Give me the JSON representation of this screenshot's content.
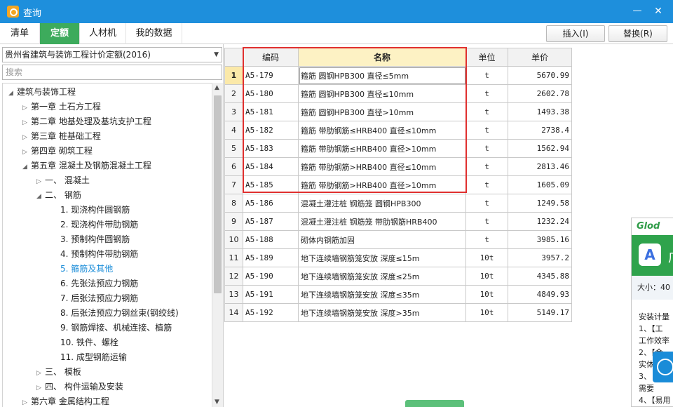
{
  "window": {
    "title": "查询",
    "minimize": "—",
    "close": "✕"
  },
  "tabs": [
    {
      "label": "清单"
    },
    {
      "label": "定额"
    },
    {
      "label": "人材机"
    },
    {
      "label": "我的数据"
    }
  ],
  "toolbar": {
    "insert": "插入(I)",
    "replace": "替换(R)"
  },
  "left": {
    "dropdown_value": "贵州省建筑与装饰工程计价定额(2016)",
    "search_placeholder": "搜索",
    "tree": [
      {
        "label": "建筑与装饰工程",
        "state": "expanded"
      },
      {
        "label": "第一章 土石方工程",
        "state": "collapsed"
      },
      {
        "label": "第二章 地基处理及基坑支护工程",
        "state": "collapsed"
      },
      {
        "label": "第三章 桩基础工程",
        "state": "collapsed"
      },
      {
        "label": "第四章 砌筑工程",
        "state": "collapsed"
      },
      {
        "label": "第五章 混凝土及钢筋混凝土工程",
        "state": "expanded"
      },
      {
        "label": "一、 混凝土",
        "state": "collapsed"
      },
      {
        "label": "二、 钢筋",
        "state": "expanded"
      },
      {
        "label": "1. 现浇构件圆钢筋",
        "state": "leaf"
      },
      {
        "label": "2. 现浇构件带肋钢筋",
        "state": "leaf"
      },
      {
        "label": "3. 预制构件圆钢筋",
        "state": "leaf"
      },
      {
        "label": "4. 预制构件带肋钢筋",
        "state": "leaf"
      },
      {
        "label": "5. 箍筋及其他",
        "state": "leaf",
        "selected": true
      },
      {
        "label": "6. 先张法预应力钢筋",
        "state": "leaf"
      },
      {
        "label": "7. 后张法预应力钢筋",
        "state": "leaf"
      },
      {
        "label": "8. 后张法预应力钢丝束(钢绞线)",
        "state": "leaf"
      },
      {
        "label": "9. 钢筋焊接、机械连接、植筋",
        "state": "leaf"
      },
      {
        "label": "10. 铁件、螺栓",
        "state": "leaf"
      },
      {
        "label": "11. 成型钢筋运输",
        "state": "leaf"
      },
      {
        "label": "三、 模板",
        "state": "collapsed"
      },
      {
        "label": "四、 构件运输及安装",
        "state": "collapsed"
      },
      {
        "label": "第六章 金属结构工程",
        "state": "collapsed"
      }
    ]
  },
  "grid": {
    "headers": {
      "code": "编码",
      "name": "名称",
      "unit": "单位",
      "price": "单价"
    },
    "rows": [
      {
        "n": "1",
        "code": "A5-179",
        "name": "箍筋 圆钢HPB300 直径≤5mm",
        "unit": "t",
        "price": "5670.99"
      },
      {
        "n": "2",
        "code": "A5-180",
        "name": "箍筋 圆钢HPB300 直径≤10mm",
        "unit": "t",
        "price": "2602.78"
      },
      {
        "n": "3",
        "code": "A5-181",
        "name": "箍筋 圆钢HPB300 直径>10mm",
        "unit": "t",
        "price": "1493.38"
      },
      {
        "n": "4",
        "code": "A5-182",
        "name": "箍筋 带肋钢筋≤HRB400 直径≤10mm",
        "unit": "t",
        "price": "2738.4"
      },
      {
        "n": "5",
        "code": "A5-183",
        "name": "箍筋 带肋钢筋≤HRB400 直径>10mm",
        "unit": "t",
        "price": "1562.94"
      },
      {
        "n": "6",
        "code": "A5-184",
        "name": "箍筋 带肋钢筋>HRB400 直径≤10mm",
        "unit": "t",
        "price": "2813.46"
      },
      {
        "n": "7",
        "code": "A5-185",
        "name": "箍筋 带肋钢筋>HRB400 直径>10mm",
        "unit": "t",
        "price": "1605.09"
      },
      {
        "n": "8",
        "code": "A5-186",
        "name": "混凝土灌注桩 钢筋笼 圆钢HPB300",
        "unit": "t",
        "price": "1249.58"
      },
      {
        "n": "9",
        "code": "A5-187",
        "name": "混凝土灌注桩 钢筋笼 带肋钢筋HRB400",
        "unit": "t",
        "price": "1232.24"
      },
      {
        "n": "10",
        "code": "A5-188",
        "name": "砌体内钢筋加固",
        "unit": "t",
        "price": "3985.16"
      },
      {
        "n": "11",
        "code": "A5-189",
        "name": "地下连续墙钢筋笼安放 深度≤15m",
        "unit": "10t",
        "price": "3957.2"
      },
      {
        "n": "12",
        "code": "A5-190",
        "name": "地下连续墙钢筋笼安放 深度≤25m",
        "unit": "10t",
        "price": "4345.88"
      },
      {
        "n": "13",
        "code": "A5-191",
        "name": "地下连续墙钢筋笼安放 深度≤35m",
        "unit": "10t",
        "price": "4849.93"
      },
      {
        "n": "14",
        "code": "A5-192",
        "name": "地下连续墙钢筋笼安放 深度>35m",
        "unit": "10t",
        "price": "5149.17"
      }
    ]
  },
  "ad": {
    "logo": "Glod",
    "trail": "广",
    "size": "大小：40",
    "lines": [
      "安装计量",
      "1、【工",
      "工作效率",
      "2、【金",
      "实体",
      "3、",
      "需要",
      "4、【易用"
    ]
  },
  "colors": {
    "titlebar": "#1e8fdc",
    "active_tab": "#3dab5c",
    "highlight_box": "#e0302f",
    "name_header": "#fdf2c4"
  }
}
